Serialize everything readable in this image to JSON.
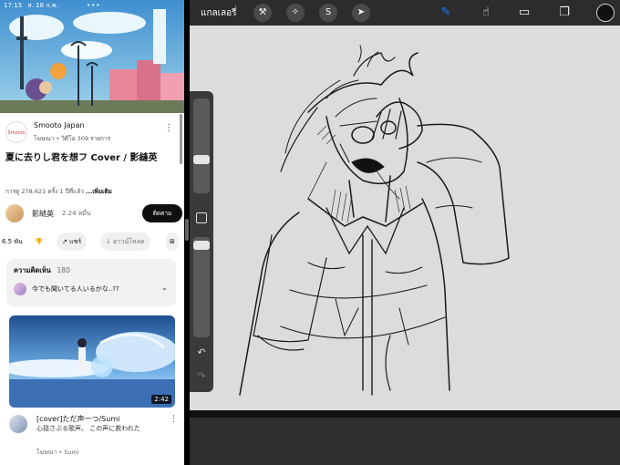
{
  "status": {
    "time": "17:15",
    "date": "ส. 18 ก.พ."
  },
  "video": {
    "channel_name": "Smooto Japan",
    "channel_logo_text": "Smooto",
    "channel_meta": "โฆษณา • วิดีโอ 309 รายการ",
    "title": "夏に去りし君を想フ Cover / 影縫英",
    "views_meta": "การดู 278,621 ครั้ง  1 ปีที่แล้ว",
    "more_label": "...เพิ่มเติม",
    "artist_name": "影縫英",
    "artist_subs": "2.24 หมื่น",
    "subscribe_label": "ติดตาม",
    "likes": "6.5 พัน",
    "share_label": "แชร์",
    "download_label": "ดาวน์โหลด",
    "comments_label": "ความคิดเห็น",
    "comments_count": "180",
    "top_comment": "今でも聞いてる人いるかな..??"
  },
  "recommended": {
    "duration": "2:42",
    "title": "[cover]ただ声一つ/Sumi",
    "subtitle": "心揺さぶる歌声。 この声に救われた",
    "meta": "โฆษณา • Sumi"
  },
  "procreate": {
    "gallery_label": "แกลเลอรี่",
    "tools": [
      "wrench-icon",
      "magic-wand-icon",
      "selection-icon",
      "transform-icon"
    ],
    "brush_color": "#111111",
    "accent": "#1a7cff"
  }
}
